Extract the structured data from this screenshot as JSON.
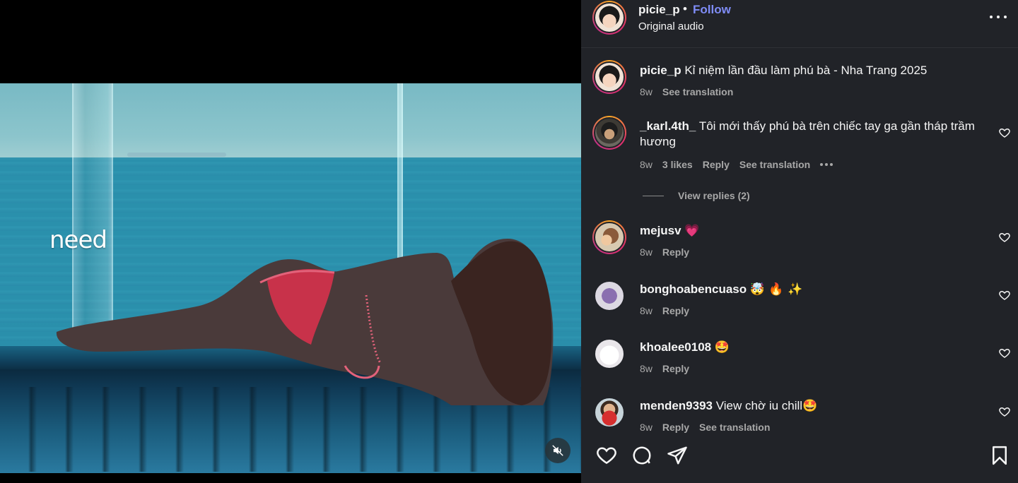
{
  "media": {
    "overlay_text": "need",
    "mute_icon": "speaker-muted-icon"
  },
  "header": {
    "username": "picie_p",
    "separator": "•",
    "follow_label": "Follow",
    "audio_label": "Original audio",
    "more_icon": "more-horizontal-icon"
  },
  "caption": {
    "username": "picie_p",
    "text": "Kỉ niệm lần đầu làm phú bà - Nha Trang 2025",
    "time": "8w",
    "see_translation": "See translation"
  },
  "comments": [
    {
      "username": "_karl.4th_",
      "text": "Tôi mới thấy phú bà trên chiếc tay ga gần tháp trầm hương",
      "time": "8w",
      "likes": "3 likes",
      "reply": "Reply",
      "see_translation": "See translation",
      "view_replies": "View replies (2)"
    },
    {
      "username": "mejusv",
      "text": "💗",
      "time": "8w",
      "reply": "Reply"
    },
    {
      "username": "bonghoabencuaso",
      "text": "🤯 🔥 ✨",
      "time": "8w",
      "reply": "Reply"
    },
    {
      "username": "khoalee0108",
      "text": "🤩",
      "time": "8w",
      "reply": "Reply"
    },
    {
      "username": "menden9393",
      "text": "View chờ iu chill🤩",
      "time": "8w",
      "reply": "Reply",
      "see_translation": "See translation"
    }
  ],
  "actions": {
    "like_icon": "heart-icon",
    "comment_icon": "comment-bubble-icon",
    "share_icon": "paper-plane-icon",
    "save_icon": "bookmark-icon"
  },
  "colors": {
    "panel_bg": "#212328",
    "follow_blue": "#7f8cf6",
    "meta_gray": "#a8a8a8",
    "text": "#f5f5f5"
  }
}
